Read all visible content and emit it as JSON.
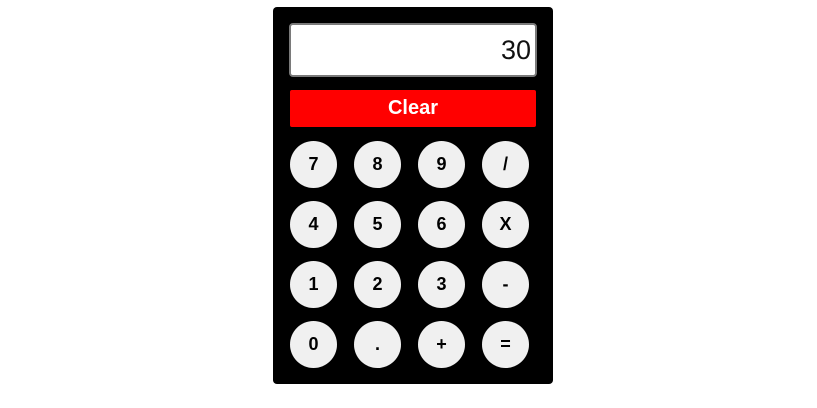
{
  "calculator": {
    "display_value": "30",
    "clear_label": "Clear",
    "keys": [
      {
        "label": "7",
        "name": "key-7"
      },
      {
        "label": "8",
        "name": "key-8"
      },
      {
        "label": "9",
        "name": "key-9"
      },
      {
        "label": "/",
        "name": "key-divide"
      },
      {
        "label": "4",
        "name": "key-4"
      },
      {
        "label": "5",
        "name": "key-5"
      },
      {
        "label": "6",
        "name": "key-6"
      },
      {
        "label": "X",
        "name": "key-multiply"
      },
      {
        "label": "1",
        "name": "key-1"
      },
      {
        "label": "2",
        "name": "key-2"
      },
      {
        "label": "3",
        "name": "key-3"
      },
      {
        "label": "-",
        "name": "key-subtract"
      },
      {
        "label": "0",
        "name": "key-0"
      },
      {
        "label": ".",
        "name": "key-decimal"
      },
      {
        "label": "+",
        "name": "key-add"
      },
      {
        "label": "=",
        "name": "key-equals"
      }
    ]
  },
  "colors": {
    "body": "#000000",
    "clear": "#ff0000",
    "key": "#f0f0f0",
    "display": "#ffffff"
  }
}
